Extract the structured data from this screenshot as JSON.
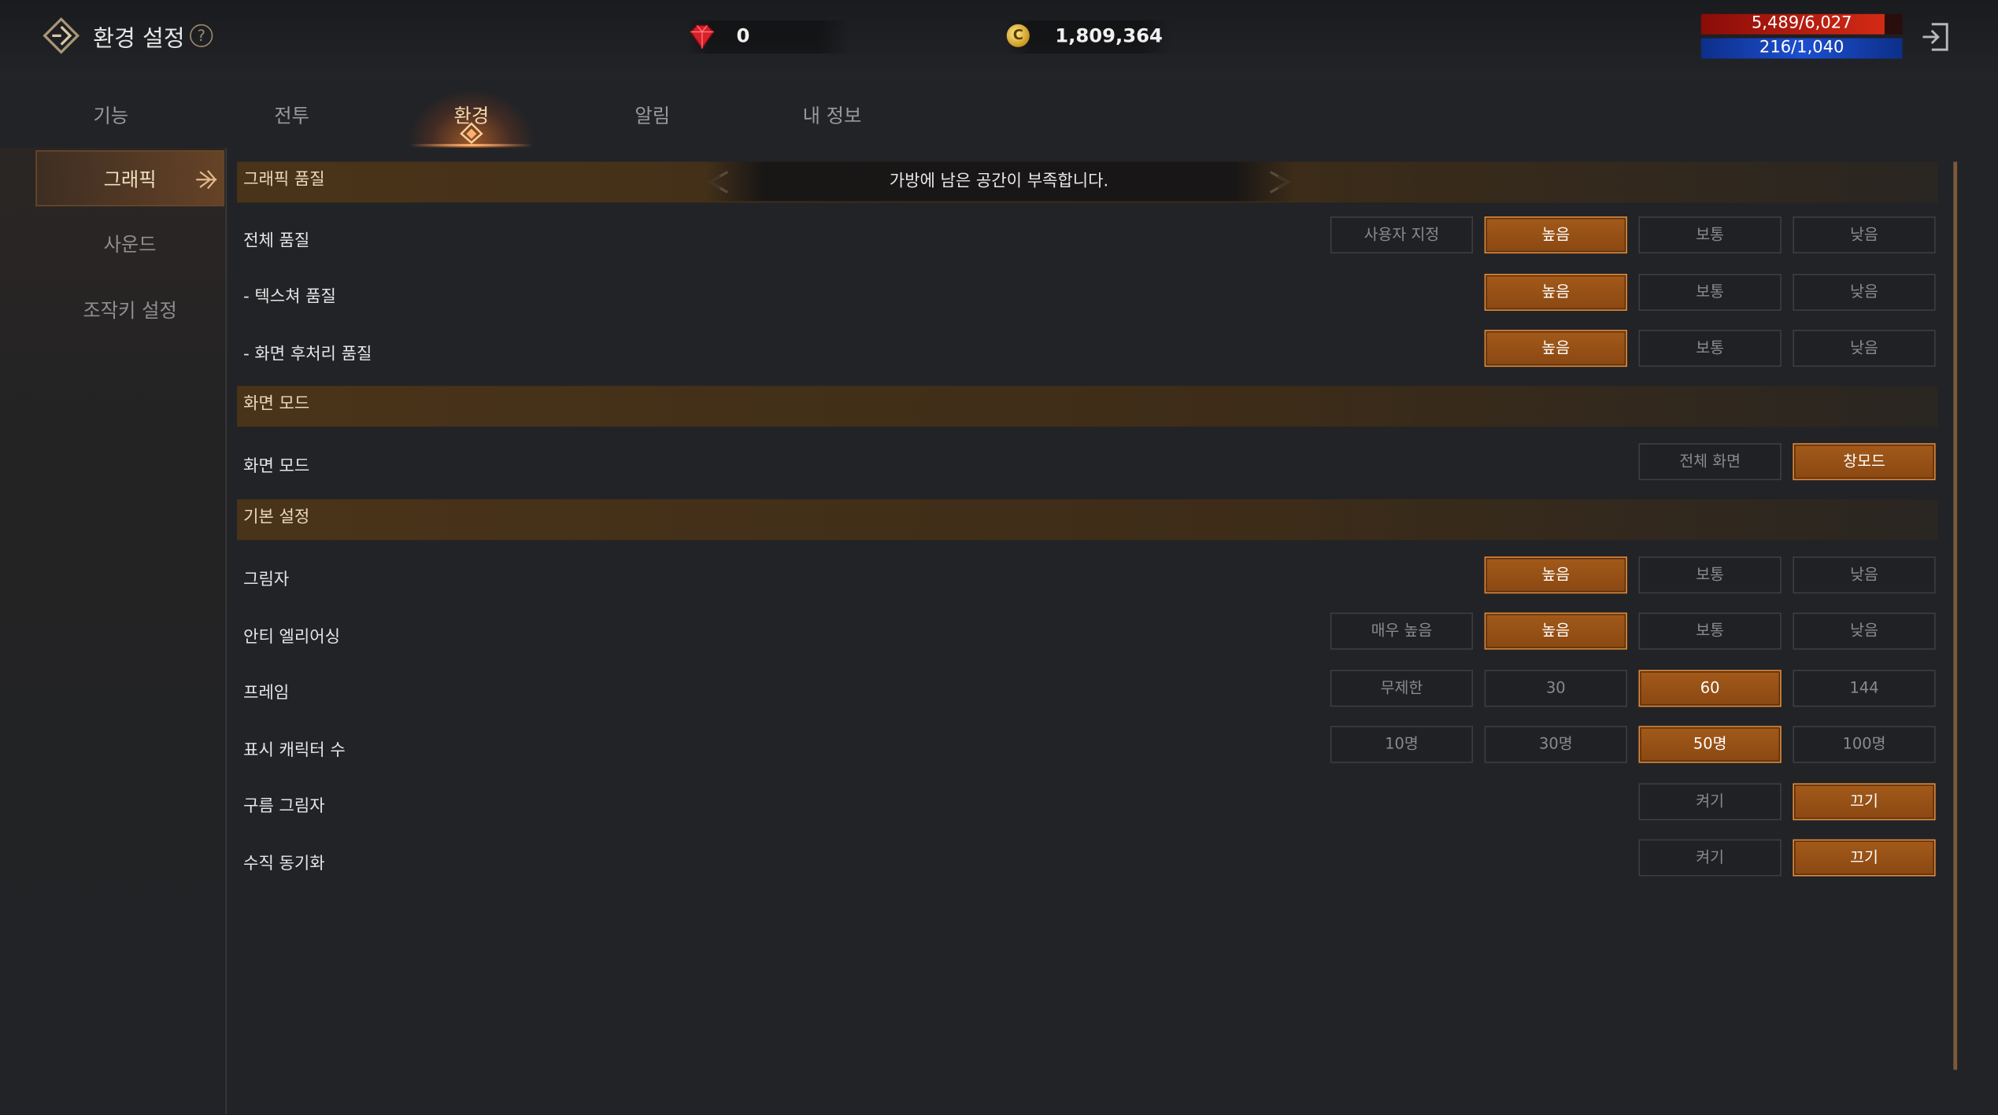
{
  "header": {
    "title": "환경 설정",
    "help_icon": "?",
    "gem_count": "0",
    "gold_amount": "1,809,364",
    "coin_glyph": "C",
    "hp_text": "5,489/6,027",
    "hp_fraction": 0.91,
    "mp_text": "216/1,040",
    "mp_fraction": 1.0
  },
  "tabs": [
    {
      "label": "기능"
    },
    {
      "label": "전투"
    },
    {
      "label": "환경"
    },
    {
      "label": "알림"
    },
    {
      "label": "내 정보"
    }
  ],
  "active_tab": "환경",
  "sidebar": {
    "items": [
      {
        "label": "그래픽"
      },
      {
        "label": "사운드"
      },
      {
        "label": "조작키 설정"
      }
    ]
  },
  "toast": "가방에 남은 공간이 부족합니다.",
  "sections": {
    "graphics_quality": "그래픽 품질",
    "screen_mode": "화면 모드",
    "basic": "기본 설정"
  },
  "rows": {
    "overall_quality": {
      "label": "전체 품질",
      "options": [
        "사용자 지정",
        "높음",
        "보통",
        "낮음"
      ],
      "selected": "높음"
    },
    "texture_quality": {
      "label": "- 텍스쳐 품질",
      "options": [
        "높음",
        "보통",
        "낮음"
      ],
      "selected": "높음"
    },
    "post_quality": {
      "label": "- 화면 후처리 품질",
      "options": [
        "높음",
        "보통",
        "낮음"
      ],
      "selected": "높음"
    },
    "screen_mode": {
      "label": "화면 모드",
      "options": [
        "전체 화면",
        "창모드"
      ],
      "selected": "창모드"
    },
    "shadow": {
      "label": "그림자",
      "options": [
        "높음",
        "보통",
        "낮음"
      ],
      "selected": "높음"
    },
    "anti_aliasing": {
      "label": "안티 엘리어싱",
      "options": [
        "매우 높음",
        "높음",
        "보통",
        "낮음"
      ],
      "selected": "높음"
    },
    "frame": {
      "label": "프레임",
      "options": [
        "무제한",
        "30",
        "60",
        "144"
      ],
      "selected": "60"
    },
    "display_chars": {
      "label": "표시 캐릭터 수",
      "options": [
        "10명",
        "30명",
        "50명",
        "100명"
      ],
      "selected": "50명"
    },
    "cloud_shadow": {
      "label": "구름 그림자",
      "options": [
        "켜기",
        "끄기"
      ],
      "selected": "끄기"
    },
    "vsync": {
      "label": "수직 동기화",
      "options": [
        "켜기",
        "끄기"
      ],
      "selected": "끄기"
    }
  },
  "colors": {
    "accent": "#a35a1a",
    "accent_border": "#e08a3c",
    "hp": "#c41c12",
    "mp": "#1c4fd0"
  }
}
